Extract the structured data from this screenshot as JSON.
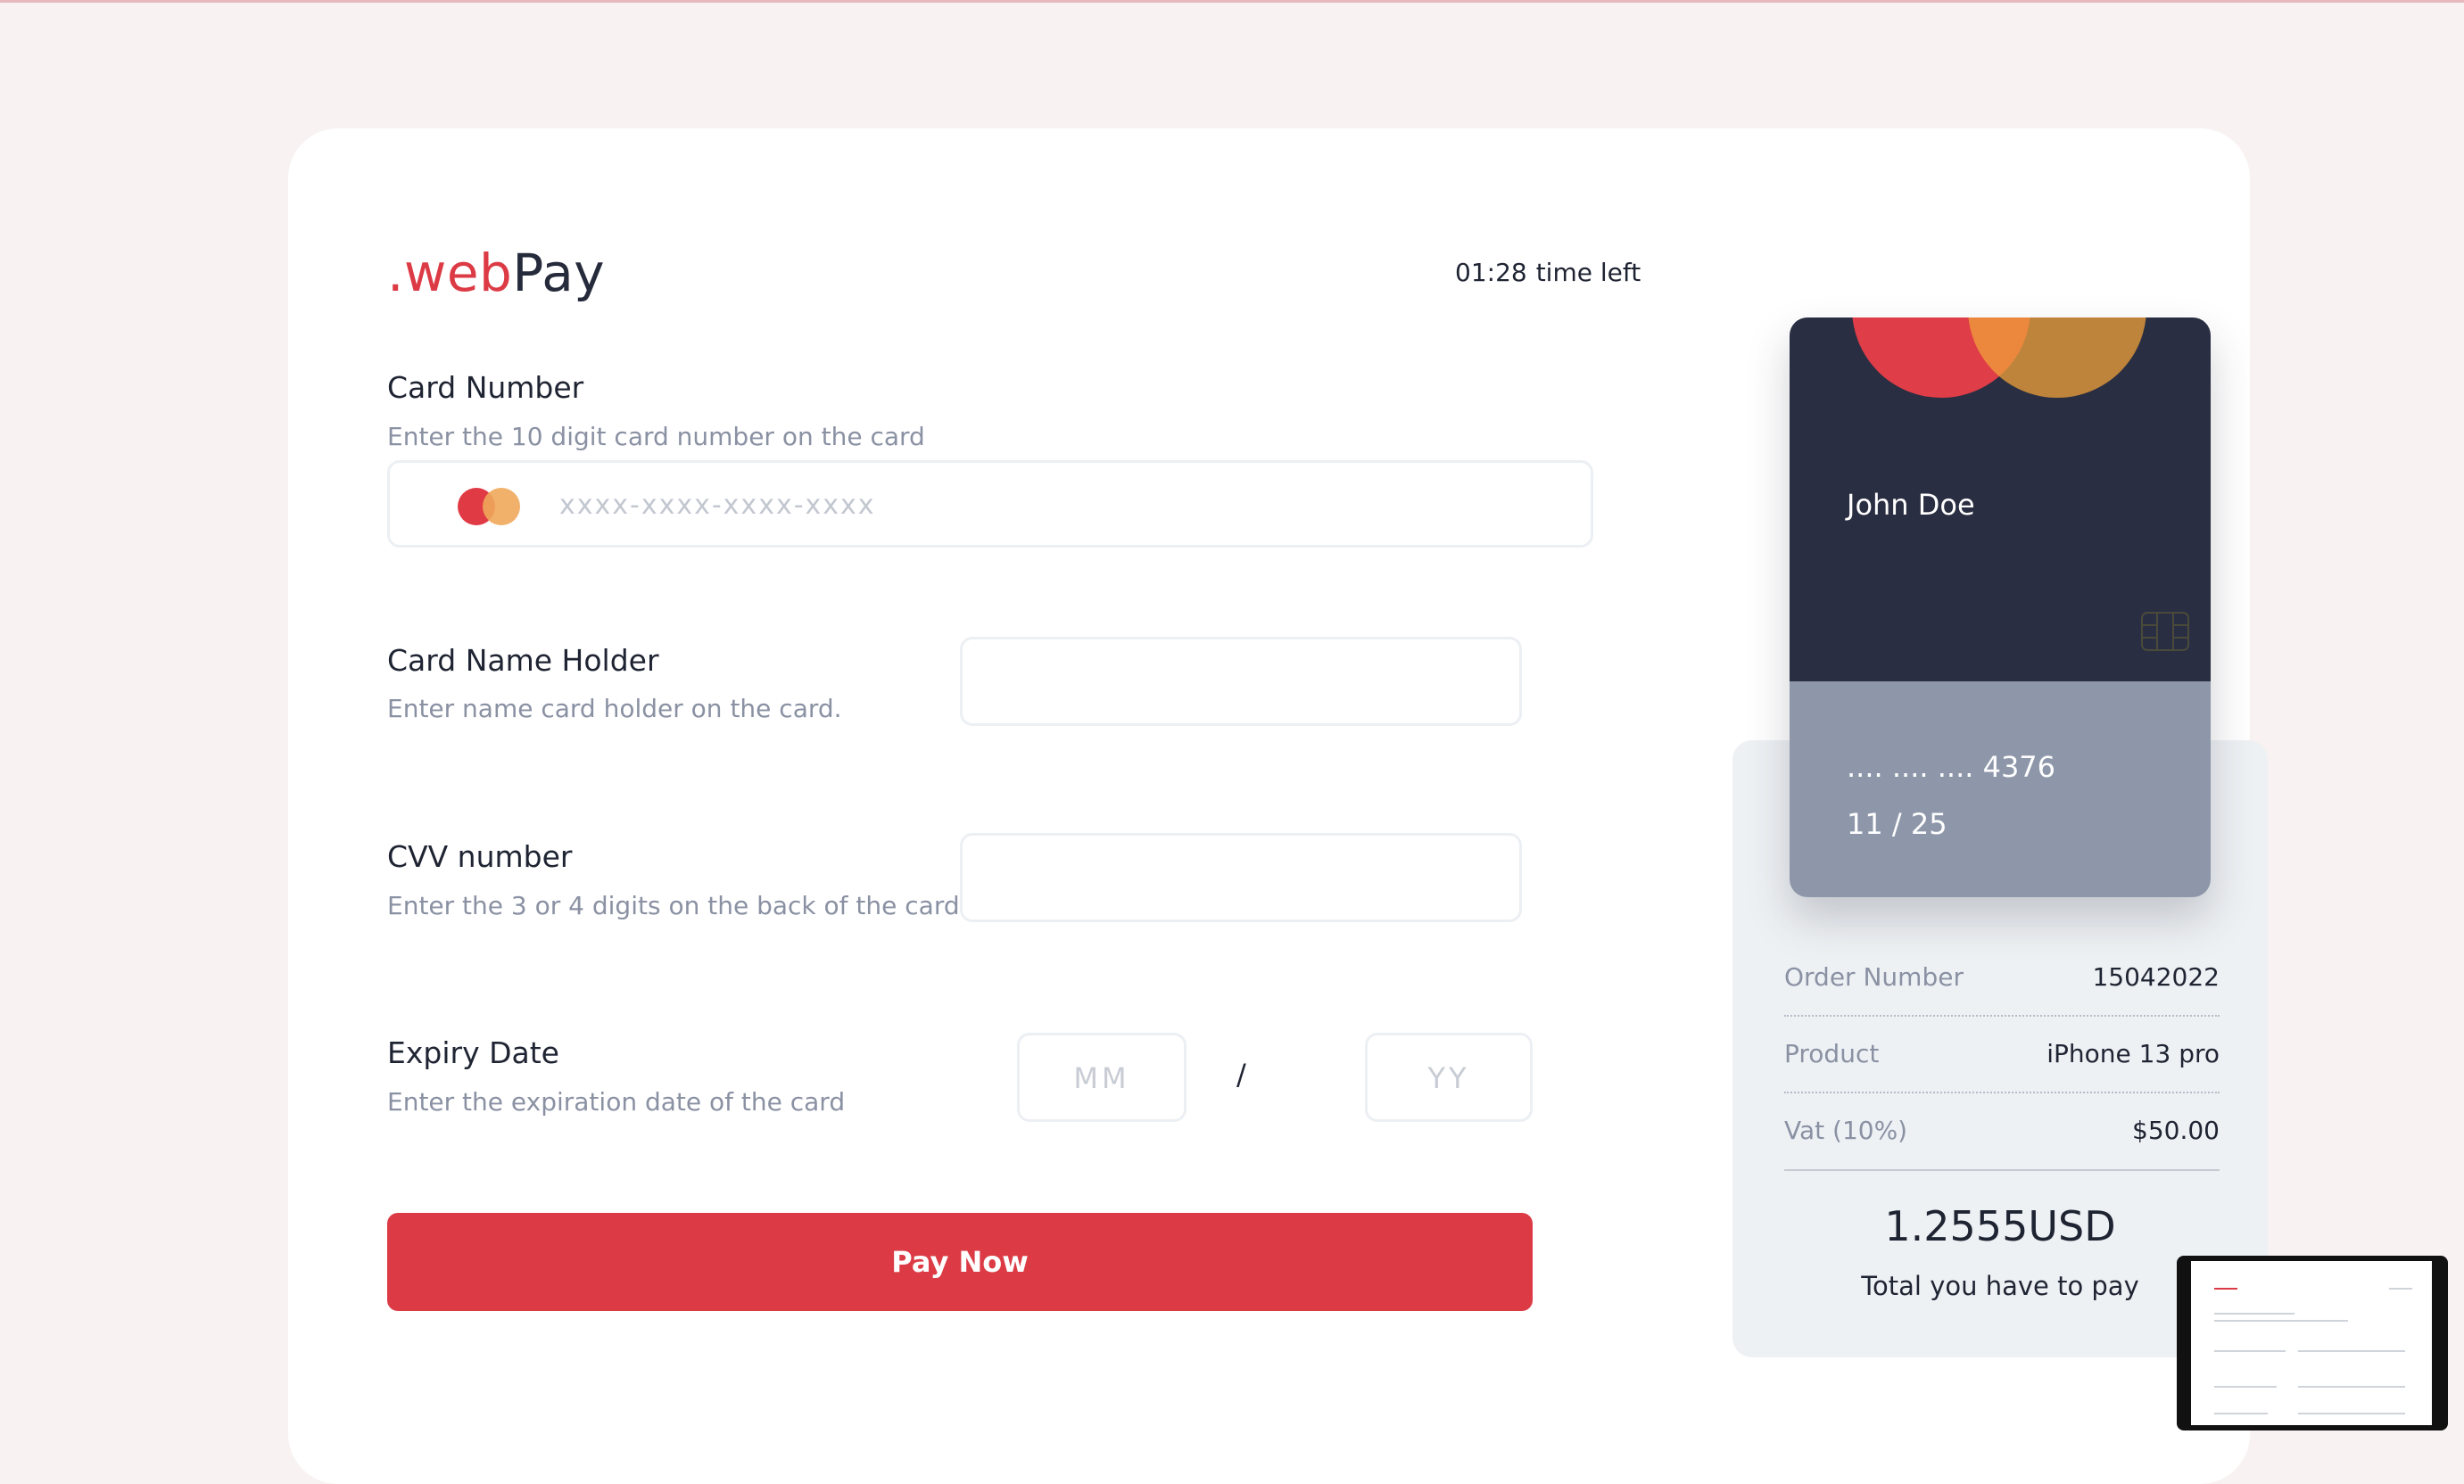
{
  "brand": {
    "prefix": ".web",
    "suffix": "Pay"
  },
  "timer": {
    "time": "01:28",
    "label": "time left"
  },
  "form": {
    "card_number": {
      "label": "Card Number",
      "hint": "Enter the 10 digit card number on the card",
      "placeholder": "xxxx-xxxx-xxxx-xxxx"
    },
    "card_holder": {
      "label": "Card Name Holder",
      "hint": "Enter name card holder on the card."
    },
    "cvv": {
      "label": "CVV number",
      "hint": "Enter the 3 or 4 digits on the back of the card"
    },
    "expiry": {
      "label": "Expiry Date",
      "hint": "Enter the expiration date of the card",
      "month_placeholder": "MM",
      "year_placeholder": "YY",
      "separator": "/"
    },
    "submit_label": "Pay Now"
  },
  "card_preview": {
    "holder": "John Doe",
    "number": ".... .... .... 4376",
    "expiry": "11 / 25",
    "brand_icon": "mastercard-logo",
    "chip_icon": "chip-icon"
  },
  "summary": {
    "rows": [
      {
        "label": "Order Number",
        "value": "15042022"
      },
      {
        "label": "Product",
        "value": "iPhone 13 pro"
      },
      {
        "label": "Vat (10%)",
        "value": "$50.00"
      }
    ],
    "total_amount": "1.2555USD",
    "total_label": "Total you have to pay"
  },
  "colors": {
    "accent": "#dc3b45",
    "card_dark": "#2a2e42",
    "card_light": "#8e97aa",
    "summary_bg": "#eef1f4"
  }
}
